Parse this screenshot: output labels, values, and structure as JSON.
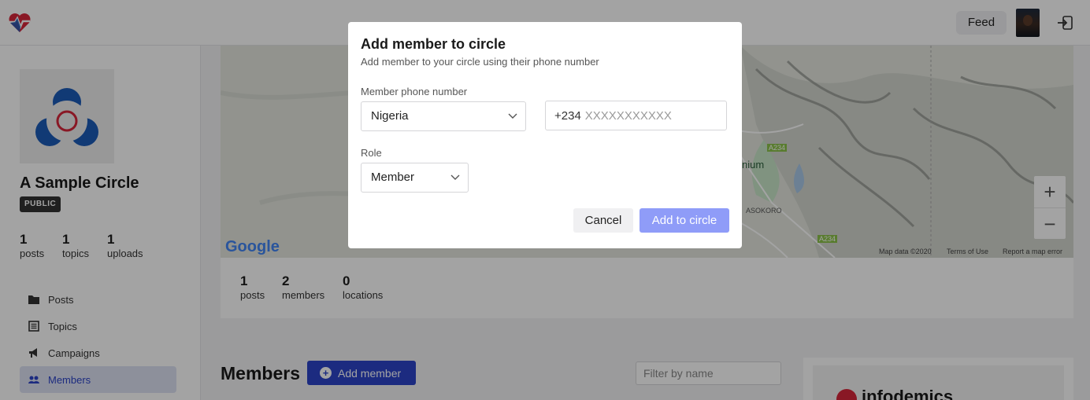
{
  "topbar": {
    "feed_label": "Feed"
  },
  "circle": {
    "name": "A Sample Circle",
    "visibility_badge": "PUBLIC",
    "stats": [
      {
        "num": "1",
        "label": "posts"
      },
      {
        "num": "1",
        "label": "topics"
      },
      {
        "num": "1",
        "label": "uploads"
      }
    ]
  },
  "sidebar": {
    "items": [
      {
        "label": "Posts",
        "icon": "folder-icon"
      },
      {
        "label": "Topics",
        "icon": "topics-icon"
      },
      {
        "label": "Campaigns",
        "icon": "megaphone-icon"
      },
      {
        "label": "Members",
        "icon": "members-icon",
        "active": true
      }
    ]
  },
  "map": {
    "labels": {
      "road1": "A234",
      "road2": "A234",
      "place1": "nium",
      "place2": "ASOKORO",
      "map_data": "Map data ©2020",
      "terms": "Terms of Use",
      "report": "Report a map error",
      "google": "Google"
    },
    "zoom_in": "+",
    "zoom_out": "−"
  },
  "main_stats": [
    {
      "num": "1",
      "label": "posts"
    },
    {
      "num": "2",
      "label": "members"
    },
    {
      "num": "0",
      "label": "locations"
    }
  ],
  "members_section": {
    "title": "Members",
    "add_button": "Add member",
    "filter_placeholder": "Filter by name",
    "side_card_word": "infodemics"
  },
  "modal": {
    "title": "Add member to circle",
    "subtitle": "Add member to your circle using their phone number",
    "phone_label": "Member phone number",
    "country_value": "Nigeria",
    "phone_prefix": "+234",
    "phone_placeholder": "XXXXXXXXXXX",
    "role_label": "Role",
    "role_value": "Member",
    "cancel_label": "Cancel",
    "submit_label": "Add to circle"
  },
  "colors": {
    "accent": "#2d44c8",
    "submit_disabled": "#8f9cf8",
    "brand_red": "#d6263b",
    "brand_blue": "#1c5bb8"
  }
}
